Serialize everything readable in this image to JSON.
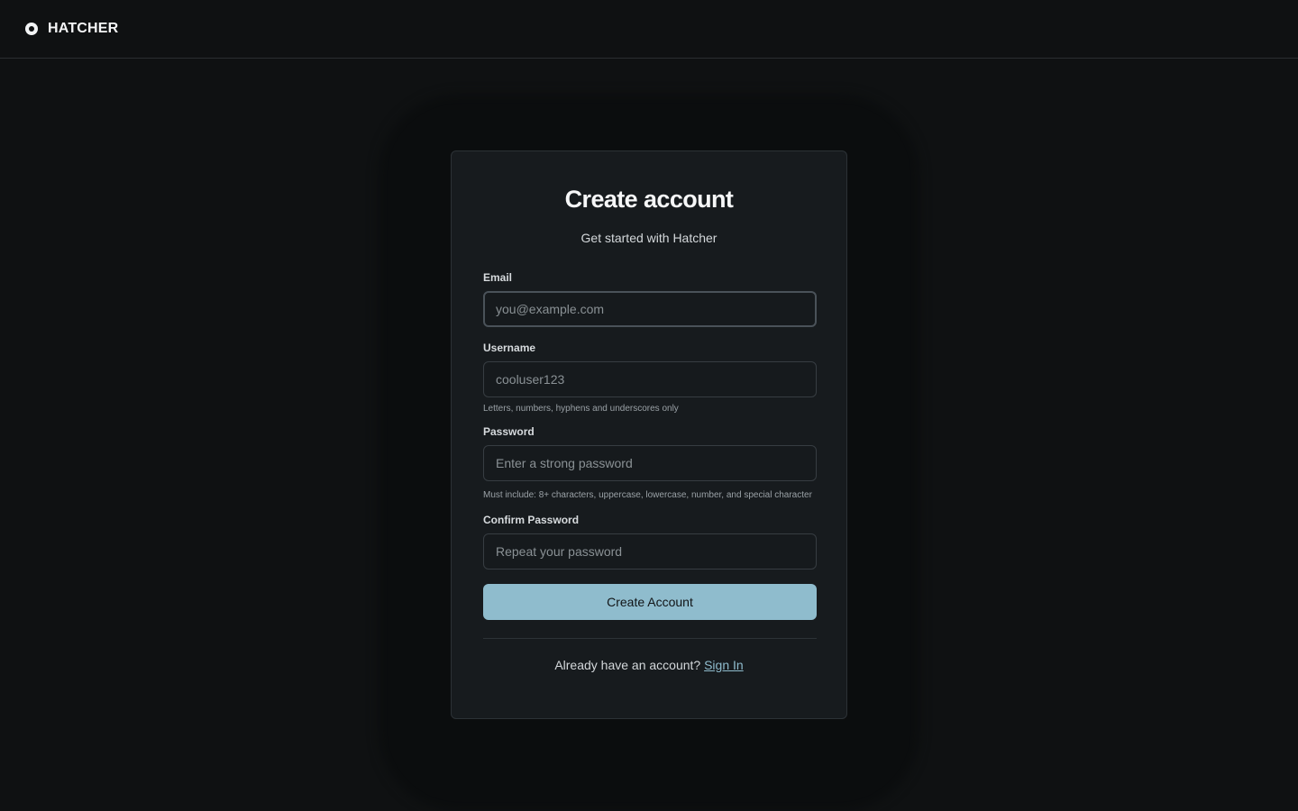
{
  "header": {
    "brand_name": "HATCHER",
    "logo_icon": "hatcher-logo-icon"
  },
  "form": {
    "title": "Create account",
    "subtitle": "Get started with Hatcher",
    "email": {
      "label": "Email",
      "placeholder": "you@example.com",
      "value": ""
    },
    "username": {
      "label": "Username",
      "placeholder": "cooluser123",
      "value": "",
      "hint": "Letters, numbers, hyphens and underscores only"
    },
    "password": {
      "label": "Password",
      "placeholder": "Enter a strong password",
      "value": "",
      "hint": "Must include: 8+ characters, uppercase, lowercase, number, and special character"
    },
    "confirm_password": {
      "label": "Confirm Password",
      "placeholder": "Repeat your password",
      "value": ""
    },
    "submit_label": "Create Account",
    "footer_prompt": "Already have an account?",
    "sign_in_label": "Sign In"
  },
  "colors": {
    "background": "#0f1112",
    "card": "#171b1e",
    "accent": "#8fbccd"
  }
}
